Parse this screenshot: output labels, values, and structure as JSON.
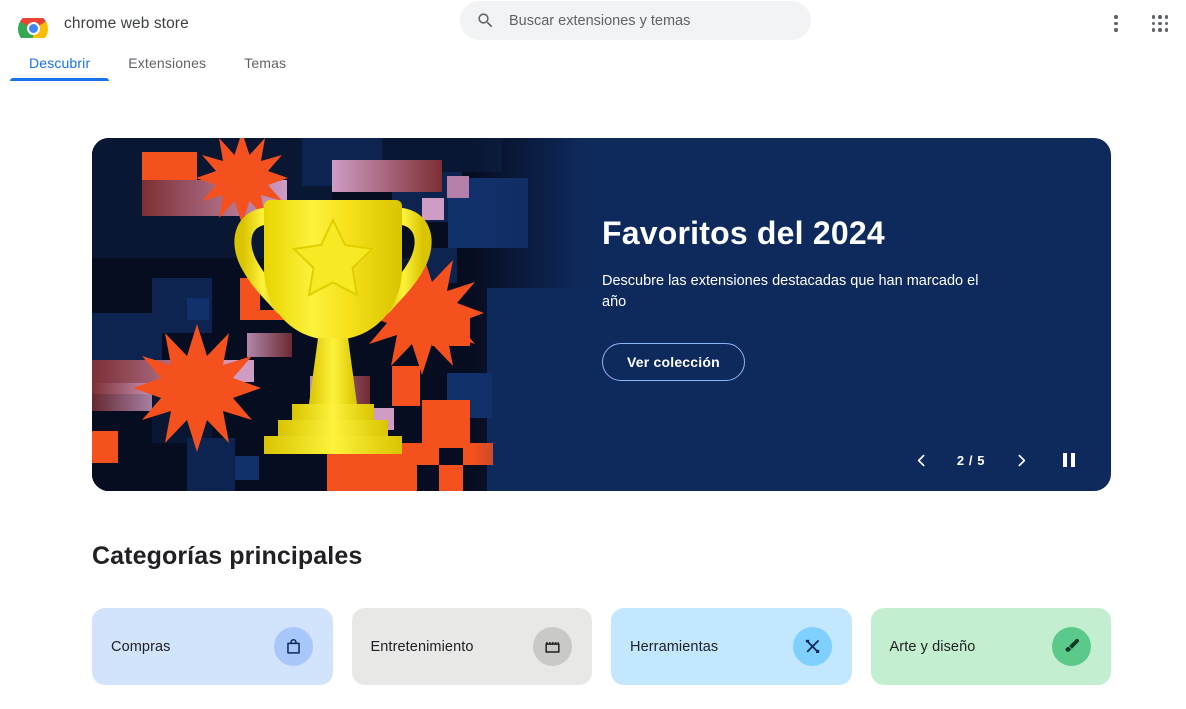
{
  "header": {
    "logo_icon": "chrome-logo-icon",
    "brand_title": "chrome web store",
    "search": {
      "icon": "search-icon",
      "placeholder": "Buscar extensiones y temas",
      "value": ""
    },
    "more_menu_icon": "more-vertical-icon",
    "apps_grid_icon": "apps-grid-icon"
  },
  "tabs": [
    {
      "label": "Descubrir",
      "active": true
    },
    {
      "label": "Extensiones",
      "active": false
    },
    {
      "label": "Temas",
      "active": false
    }
  ],
  "hero": {
    "title": "Favoritos del 2024",
    "description": "Descubre las extensiones destacadas que han marcado el año",
    "cta_label": "Ver colección",
    "background_color": "#0e2a5c",
    "art_background_color": "#070d21",
    "accent_orange": "#f4511e",
    "accent_yellow": "#f2e50b",
    "accent_pink": "#c58fb4",
    "cta_border_color": "#8ab4f8",
    "carousel": {
      "prev_icon": "chevron-left-icon",
      "next_icon": "chevron-right-icon",
      "pause_icon": "pause-icon",
      "current": 2,
      "total": 5,
      "counter_label": "2 / 5"
    }
  },
  "categories_section": {
    "title": "Categorías principales",
    "cards": [
      {
        "label": "Compras",
        "icon": "shopping-bag-icon",
        "card_color": "#d2e3fc",
        "icon_bg_color": "#a8c7fa",
        "icon_color": "#0b2a5b"
      },
      {
        "label": "Entretenimiento",
        "icon": "clapperboard-icon",
        "card_color": "#e8e8e6",
        "icon_bg_color": "#c9c9c5",
        "icon_color": "#202124"
      },
      {
        "label": "Herramientas",
        "icon": "hammer-wrench-icon",
        "card_color": "#c2e7ff",
        "icon_bg_color": "#7fcfff",
        "icon_color": "#0b2a5b"
      },
      {
        "label": "Arte y diseño",
        "icon": "paintbrush-icon",
        "card_color": "#c4eed0",
        "icon_bg_color": "#5bc98a",
        "icon_color": "#0d3a22"
      }
    ]
  }
}
